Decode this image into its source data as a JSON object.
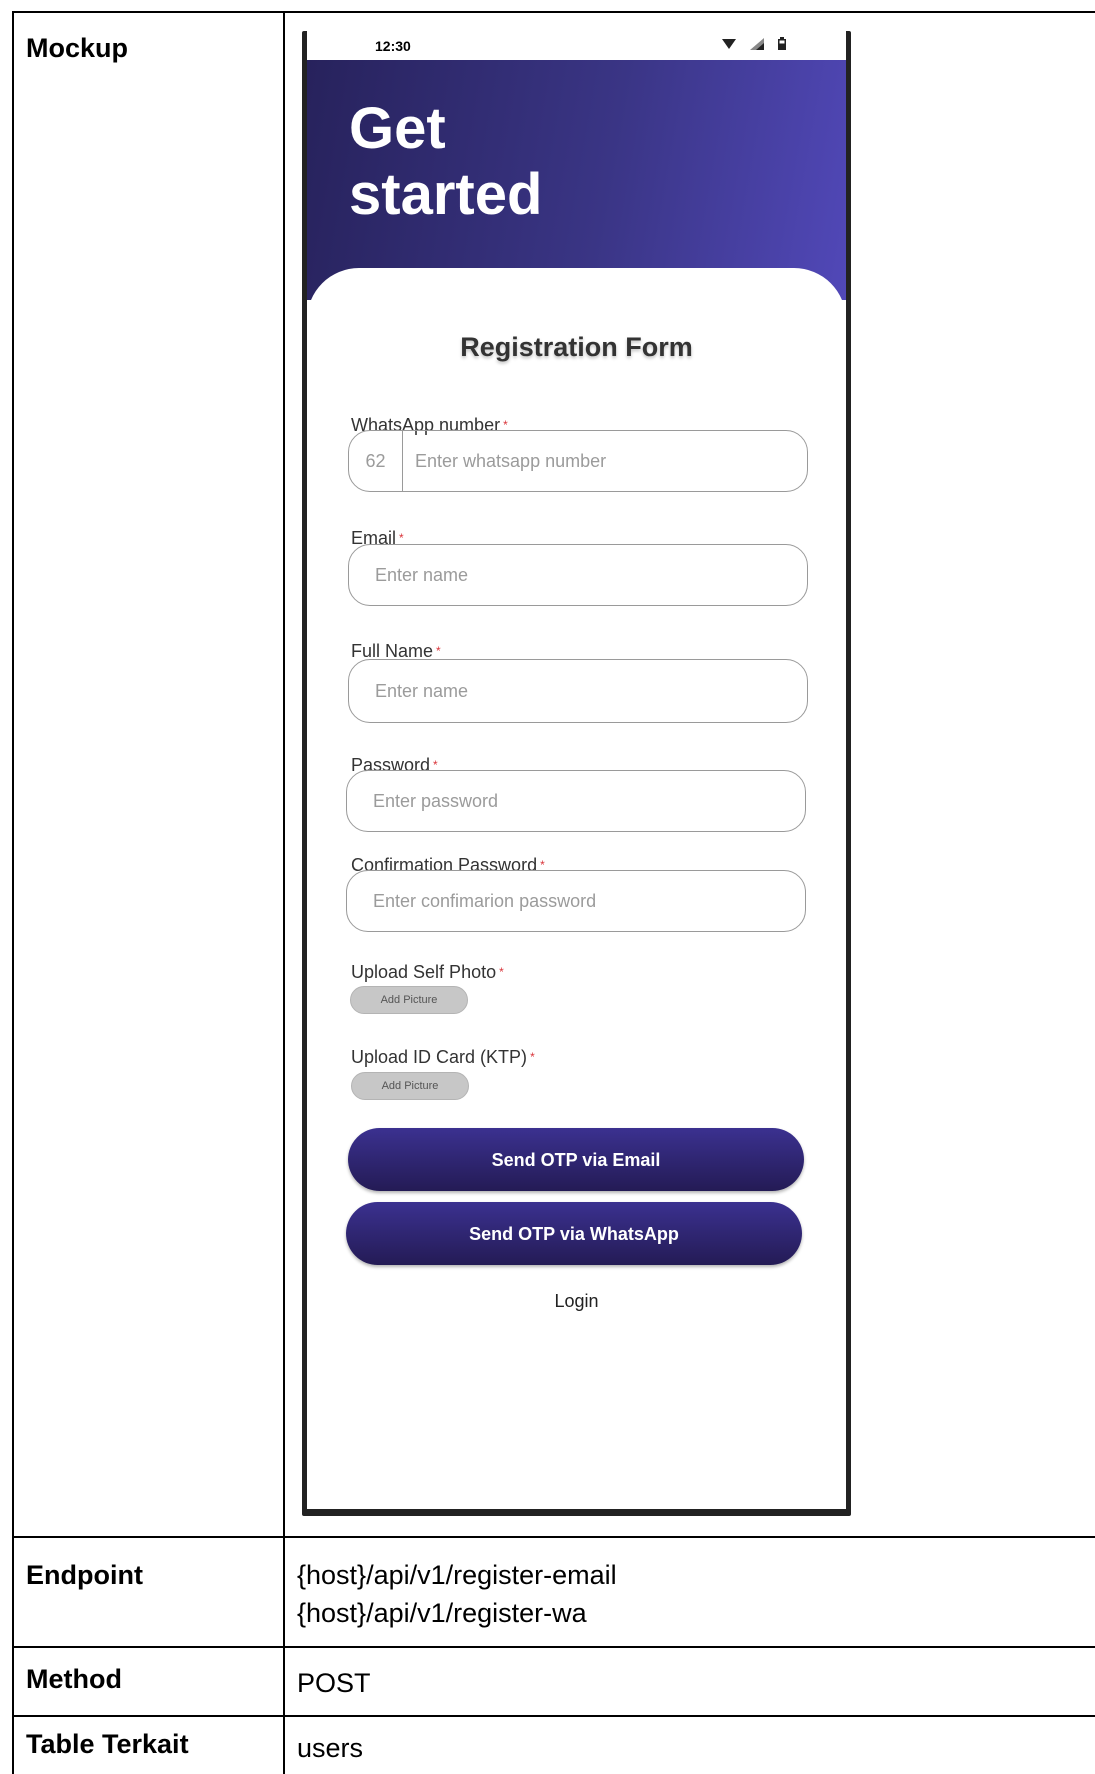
{
  "table": {
    "mockup_label": "Mockup",
    "endpoint_label": "Endpoint",
    "endpoint_line1": "{host}/api/v1/register-email",
    "endpoint_line2": "{host}/api/v1/register-wa",
    "method_label": "Method",
    "method_value": "POST",
    "table_label": "Table Terkait",
    "table_value": "users"
  },
  "phone": {
    "status_time": "12:30",
    "hero_title": "Get started",
    "form_title": "Registration Form",
    "fields": {
      "whatsapp_label": "WhatsApp number",
      "whatsapp_prefix": "62",
      "whatsapp_placeholder": "Enter whatsapp number",
      "email_label": "Email",
      "email_placeholder": "Enter name",
      "fullname_label": "Full Name",
      "fullname_placeholder": "Enter name",
      "password_label": "Password",
      "password_placeholder": "Enter password",
      "confirm_label": "Confirmation Password",
      "confirm_placeholder": "Enter confimarion password",
      "self_photo_label": "Upload Self Photo",
      "id_card_label": "Upload ID Card (KTP)",
      "add_picture": "Add Picture",
      "required_mark": "*"
    },
    "buttons": {
      "otp_email": "Send OTP via Email",
      "otp_whatsapp": "Send OTP via WhatsApp",
      "login": "Login"
    }
  },
  "colors": {
    "hero_dark": "#27225c",
    "hero_light": "#5148b8",
    "button": "#2f2773",
    "required": "#d9343a"
  },
  "icons": [
    "wifi-icon",
    "signal-icon",
    "battery-icon"
  ]
}
